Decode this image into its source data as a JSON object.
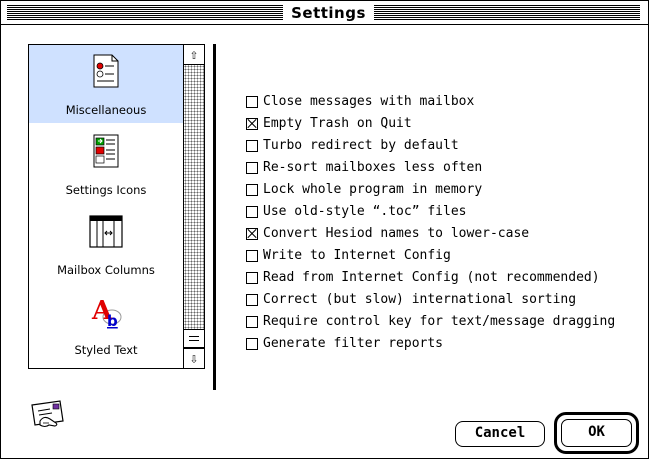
{
  "window": {
    "title": "Settings"
  },
  "sidebar": {
    "items": [
      {
        "label": "Miscellaneous",
        "icon": "checklist-page-icon",
        "selected": true
      },
      {
        "label": "Settings Icons",
        "icon": "settings-icons-icon",
        "selected": false
      },
      {
        "label": "Mailbox Columns",
        "icon": "mailbox-columns-icon",
        "selected": false
      },
      {
        "label": "Styled Text",
        "icon": "styled-text-icon",
        "selected": false
      }
    ],
    "scroll_up_glyph": "⇧",
    "scroll_down_glyph": "⇩"
  },
  "options": [
    {
      "label": "Close messages with mailbox",
      "checked": false
    },
    {
      "label": "Empty Trash on Quit",
      "checked": true
    },
    {
      "label": "Turbo redirect by default",
      "checked": false
    },
    {
      "label": "Re-sort mailboxes less often",
      "checked": false
    },
    {
      "label": "Lock whole program in memory",
      "checked": false
    },
    {
      "label": "Use old-style “.toc” files",
      "checked": false
    },
    {
      "label": "Convert Hesiod names to lower-case",
      "checked": true
    },
    {
      "label": "Write to Internet Config",
      "checked": false
    },
    {
      "label": "Read from Internet Config (not recommended)",
      "checked": false
    },
    {
      "label": "Correct (but slow) international sorting",
      "checked": false
    },
    {
      "label": "Require control key for text/message dragging",
      "checked": false
    },
    {
      "label": "Generate filter reports",
      "checked": false
    }
  ],
  "buttons": {
    "cancel": "Cancel",
    "ok": "OK"
  },
  "colors": {
    "selection": "#cfe1ff",
    "accent_red": "#e00000",
    "accent_blue": "#0000cc",
    "accent_green": "#00a000"
  }
}
